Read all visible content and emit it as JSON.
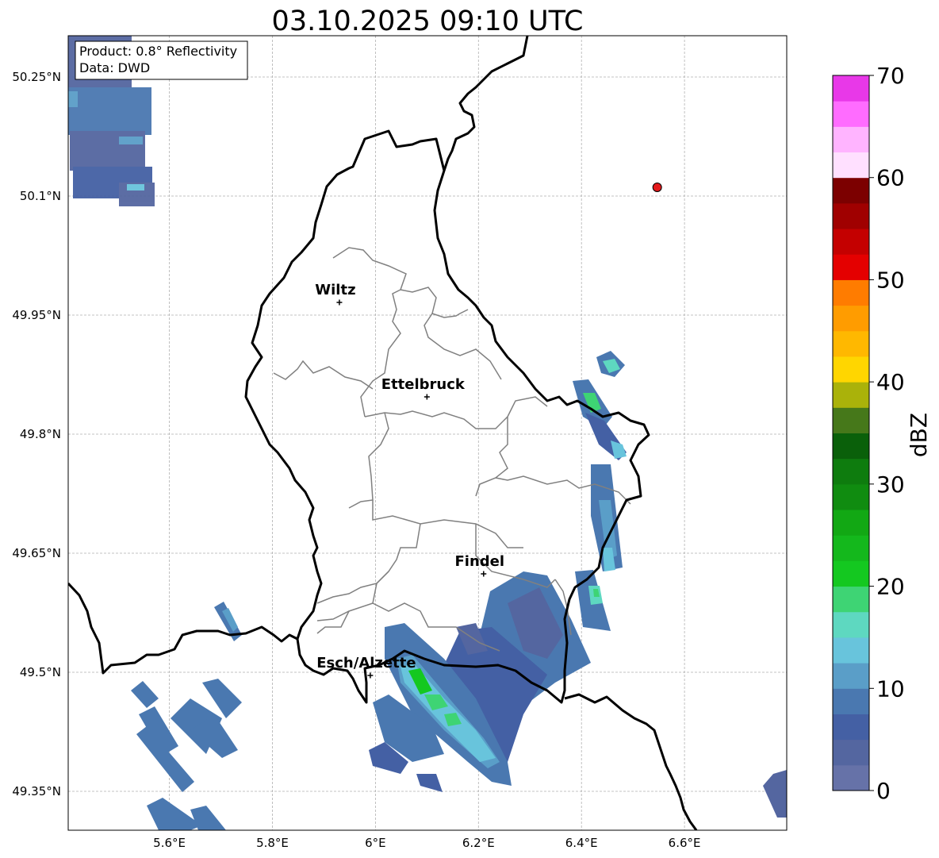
{
  "title": "03.10.2025 09:10 UTC",
  "info_box": {
    "product": "Product: 0.8° Reflectivity",
    "source": "Data: DWD"
  },
  "map": {
    "lon_range": [
      5.4,
      6.8
    ],
    "lat_range": [
      49.3,
      50.3
    ],
    "lon_ticks": [
      {
        "value": 5.6,
        "label": "5.6°E"
      },
      {
        "value": 5.8,
        "label": "5.8°E"
      },
      {
        "value": 6.0,
        "label": "6°E"
      },
      {
        "value": 6.2,
        "label": "6.2°E"
      },
      {
        "value": 6.4,
        "label": "6.4°E"
      },
      {
        "value": 6.6,
        "label": "6.6°E"
      }
    ],
    "lat_ticks": [
      {
        "value": 50.25,
        "label": "50.25°N"
      },
      {
        "value": 50.1,
        "label": "50.1°N"
      },
      {
        "value": 49.95,
        "label": "49.95°N"
      },
      {
        "value": 49.8,
        "label": "49.8°N"
      },
      {
        "value": 49.65,
        "label": "49.65°N"
      },
      {
        "value": 49.5,
        "label": "49.5°N"
      },
      {
        "value": 49.35,
        "label": "49.35°N"
      }
    ],
    "cities": [
      {
        "name": "Wiltz",
        "lon": 5.93,
        "lat": 49.966
      },
      {
        "name": "Ettelbruck",
        "lon": 6.1,
        "lat": 49.847
      },
      {
        "name": "Findel",
        "lon": 6.21,
        "lat": 49.624
      },
      {
        "name": "Esch/Alzette",
        "lon": 5.99,
        "lat": 49.496
      }
    ],
    "radar_site": {
      "lon": 6.547,
      "lat": 50.111,
      "color": "#e41a1c"
    }
  },
  "colorbar": {
    "label": "dBZ",
    "ticks": [
      0,
      10,
      20,
      30,
      40,
      50,
      60,
      70
    ],
    "range": [
      0,
      70
    ],
    "colors": [
      "#6672a8",
      "#5466a0",
      "#4460a4",
      "#4a78b0",
      "#5a9ec8",
      "#68c4dc",
      "#5ed8c0",
      "#3ed474",
      "#14c820",
      "#14b81c",
      "#12a814",
      "#108c10",
      "#0e7c0e",
      "#0a600a",
      "#46781a",
      "#aab20a",
      "#ffd600",
      "#ffb800",
      "#ff9c00",
      "#ff7c00",
      "#e40000",
      "#c40000",
      "#a00000",
      "#7c0000",
      "#ffe0ff",
      "#ffb4ff",
      "#ff6cff",
      "#e838e8"
    ]
  }
}
